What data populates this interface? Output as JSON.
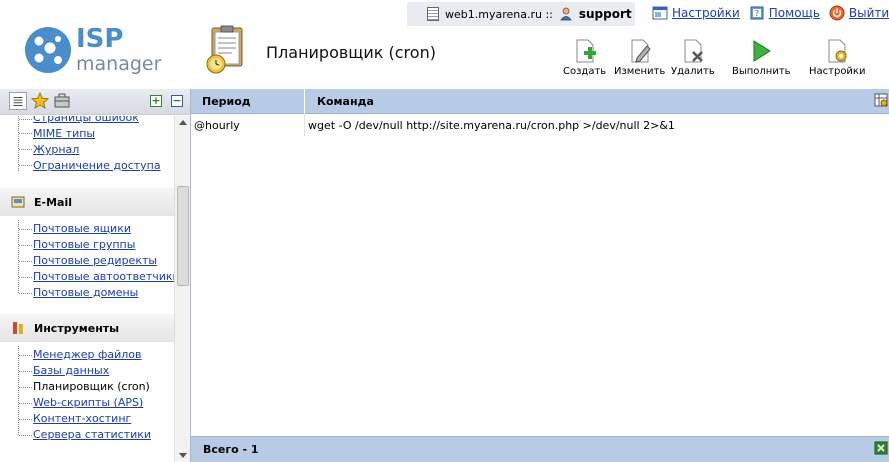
{
  "topbar": {
    "host": "web1.myarena.ru ::",
    "user": "support",
    "links": {
      "settings": "Настройки",
      "help": "Помощь",
      "logout": "Выйти"
    }
  },
  "header": {
    "logo_isp": "ISP",
    "logo_manager": "manager",
    "title": "Планировщик (cron)"
  },
  "toolbar": {
    "create": "Создать",
    "edit": "Изменить",
    "delete": "Удалить",
    "run": "Выполнить",
    "settings": "Настройки"
  },
  "sidebar": {
    "group1_items": [
      "Страницы ошибок",
      "MIME типы",
      "Журнал",
      "Ограничение доступа"
    ],
    "email": {
      "title": "E-Mail",
      "items": [
        "Почтовые ящики",
        "Почтовые группы",
        "Почтовые редиректы",
        "Почтовые автоответчики",
        "Почтовые домены"
      ]
    },
    "tools": {
      "title": "Инструменты",
      "items": [
        "Менеджер файлов",
        "Базы данных",
        "Планировщик (cron)",
        "Web-скрипты (APS)",
        "Контент-хостинг",
        "Сервера статистики"
      ]
    }
  },
  "grid": {
    "columns": [
      "Период",
      "Команда"
    ],
    "rows": [
      [
        "@hourly",
        "wget -O /dev/null http://site.myarena.ru/cron.php >/dev/null 2>&1"
      ]
    ],
    "total": "Всего - 1"
  },
  "colors": {
    "accent_blue": "#4a8ec9",
    "grid_header": "#b7cbe6",
    "link": "#1a3fa8"
  }
}
